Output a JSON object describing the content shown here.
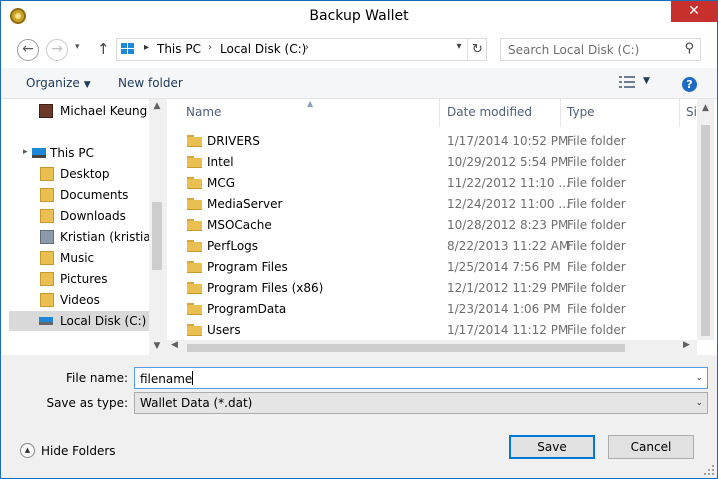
{
  "window": {
    "title": "Backup Wallet",
    "close_glyph": "✕"
  },
  "nav": {
    "back_glyph": "←",
    "forward_glyph": "→",
    "recent_glyph": "▾",
    "up_glyph": "↑",
    "address": {
      "root_sep": "▸",
      "parts": [
        "This PC",
        "Local Disk (C:)"
      ],
      "sep": "›",
      "drop_glyph": "▾",
      "refresh_glyph": "↻"
    },
    "search": {
      "placeholder": "Search Local Disk (C:)",
      "icon_glyph": "⚲"
    }
  },
  "toolbar": {
    "organize": "Organize",
    "organize_caret": "▼",
    "new_folder": "New folder",
    "view_caret": "▼",
    "help_glyph": "?"
  },
  "navpane": {
    "items": [
      {
        "label": "Michael Keung",
        "icon": "user-avatar-icon"
      },
      {
        "label": "This PC",
        "icon": "computer-icon"
      },
      {
        "label": "Desktop",
        "icon": "desktop-folder-icon"
      },
      {
        "label": "Documents",
        "icon": "documents-folder-icon"
      },
      {
        "label": "Downloads",
        "icon": "downloads-folder-icon"
      },
      {
        "label": "Kristian (kristian-",
        "icon": "network-computer-icon"
      },
      {
        "label": "Music",
        "icon": "music-folder-icon"
      },
      {
        "label": "Pictures",
        "icon": "pictures-folder-icon"
      },
      {
        "label": "Videos",
        "icon": "videos-folder-icon"
      },
      {
        "label": "Local Disk (C:)",
        "icon": "drive-icon",
        "selected": true
      }
    ],
    "expand_glyph": "▸",
    "scroll_up": "▲",
    "scroll_down": "▼"
  },
  "filelist": {
    "columns": {
      "name": "Name",
      "date": "Date modified",
      "type": "Type",
      "size": "Si"
    },
    "sort_glyph": "▲",
    "rows": [
      {
        "name": "DRIVERS",
        "date": "1/17/2014 10:52 PM",
        "type": "File folder"
      },
      {
        "name": "Intel",
        "date": "10/29/2012 5:54 PM",
        "type": "File folder"
      },
      {
        "name": "MCG",
        "date": "11/22/2012 11:10 ...",
        "type": "File folder"
      },
      {
        "name": "MediaServer",
        "date": "12/24/2012 11:00 ...",
        "type": "File folder"
      },
      {
        "name": "MSOCache",
        "date": "10/28/2012 8:23 PM",
        "type": "File folder"
      },
      {
        "name": "PerfLogs",
        "date": "8/22/2013 11:22 AM",
        "type": "File folder"
      },
      {
        "name": "Program Files",
        "date": "1/25/2014 7:56 PM",
        "type": "File folder"
      },
      {
        "name": "Program Files (x86)",
        "date": "12/1/2012 11:29 PM",
        "type": "File folder"
      },
      {
        "name": "ProgramData",
        "date": "1/23/2014 1:06 PM",
        "type": "File folder"
      },
      {
        "name": "Users",
        "date": "1/17/2014 11:12 PM",
        "type": "File folder"
      }
    ],
    "scroll_up": "▲",
    "scroll_left": "◀",
    "scroll_right": "▶"
  },
  "form": {
    "file_name_label": "File name:",
    "file_name_value": "filename",
    "save_as_label": "Save as type:",
    "save_as_value": "Wallet Data (*.dat)",
    "dropdown_glyph": "⌄"
  },
  "footer": {
    "hide_folders": "Hide Folders",
    "hide_folders_glyph": "▲",
    "save": "Save",
    "cancel": "Cancel"
  },
  "colors": {
    "accent": "#0078d7",
    "close": "#c7312d",
    "folder": "#e9bf52",
    "link_text": "#1e395b"
  }
}
